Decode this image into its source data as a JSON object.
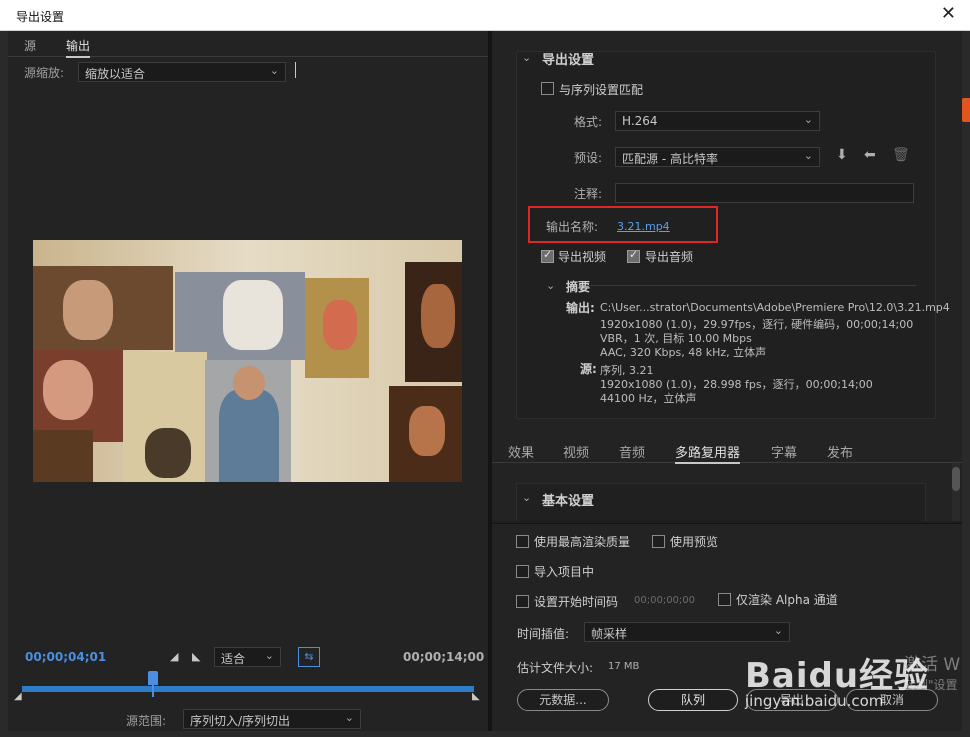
{
  "window": {
    "title": "导出设置",
    "close": "✕"
  },
  "left": {
    "tabs": [
      "源",
      "输出"
    ],
    "source_scale_label": "源缩放:",
    "source_scale_value": "缩放以适合",
    "time_current": "00;00;04;01",
    "time_end": "00;00;14;00",
    "fit_value": "适合",
    "source_range_label": "源范围:",
    "source_range_value": "序列切入/序列切出",
    "playhead_fraction": 0.29
  },
  "export": {
    "section_title": "导出设置",
    "match_sequence": "与序列设置匹配",
    "format_label": "格式:",
    "format_value": "H.264",
    "preset_label": "预设:",
    "preset_value": "匹配源 - 高比特率",
    "comment_label": "注释:",
    "comment_value": "",
    "output_name_label": "输出名称:",
    "output_name_value": "3.21.mp4",
    "export_video": "导出视频",
    "export_audio": "导出音频",
    "summary_title": "摘要",
    "output_key": "输出:",
    "output_lines": [
      "C:\\User...strator\\Documents\\Adobe\\Premiere Pro\\12.0\\3.21.mp4",
      "1920x1080 (1.0)，29.97fps，逐行, 硬件编码，00;00;14;00",
      "VBR，1 次, 目标 10.00 Mbps",
      "AAC, 320 Kbps, 48  kHz, 立体声"
    ],
    "source_key": "源:",
    "source_lines": [
      "序列, 3.21",
      "1920x1080 (1.0)，28.998 fps，逐行，00;00;14;00",
      "44100 Hz，立体声"
    ]
  },
  "tabs2": [
    "效果",
    "视频",
    "音频",
    "多路复用器",
    "字幕",
    "发布"
  ],
  "basic_settings": "基本设置",
  "bottom": {
    "max_render_quality": "使用最高渲染质量",
    "use_previews": "使用预览",
    "import_into_project": "导入项目中",
    "set_start_timecode": "设置开始时间码",
    "start_timecode_value": "00;00;00;00",
    "render_alpha_only": "仅渲染 Alpha 通道",
    "time_interp_label": "时间插值:",
    "time_interp_value": "帧采样",
    "est_file_size": "估计文件大小:",
    "est_file_size_value": "17 MB",
    "metadata_btn": "元数据...",
    "queue_btn": "队列",
    "export_btn": "导出",
    "cancel_btn": "取消"
  },
  "watermark": {
    "brand": "Baidu经验",
    "url": "jingyan.baidu.com",
    "activate": "激活 W",
    "activate_sub": "转到\"设置"
  },
  "colors": {
    "accent_blue": "#4c8fe0",
    "link_blue": "#5b9ff0",
    "highlight_red": "#e02525",
    "panel_bg": "#232323"
  }
}
